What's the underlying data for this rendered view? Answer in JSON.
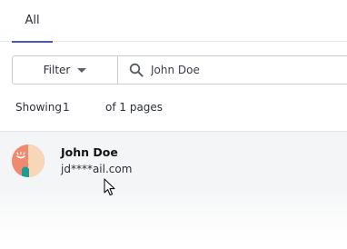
{
  "tabs": [
    {
      "label": "All",
      "active": true
    }
  ],
  "toolbar": {
    "filter_label": "Filter",
    "search_value": "John Doe",
    "search_placeholder": "Search"
  },
  "pagination": {
    "label": "Showing",
    "current_page": "1",
    "suffix": "of 1 pages"
  },
  "results": [
    {
      "name": "John Doe",
      "email": "jd****ail.com",
      "avatar_icon": "abstract-face-avatar"
    }
  ],
  "colors": {
    "accent": "#4857c7",
    "avatar_salmon": "#f08a6f",
    "avatar_peach": "#f7d7b8",
    "avatar_teal": "#1f9b8f"
  }
}
